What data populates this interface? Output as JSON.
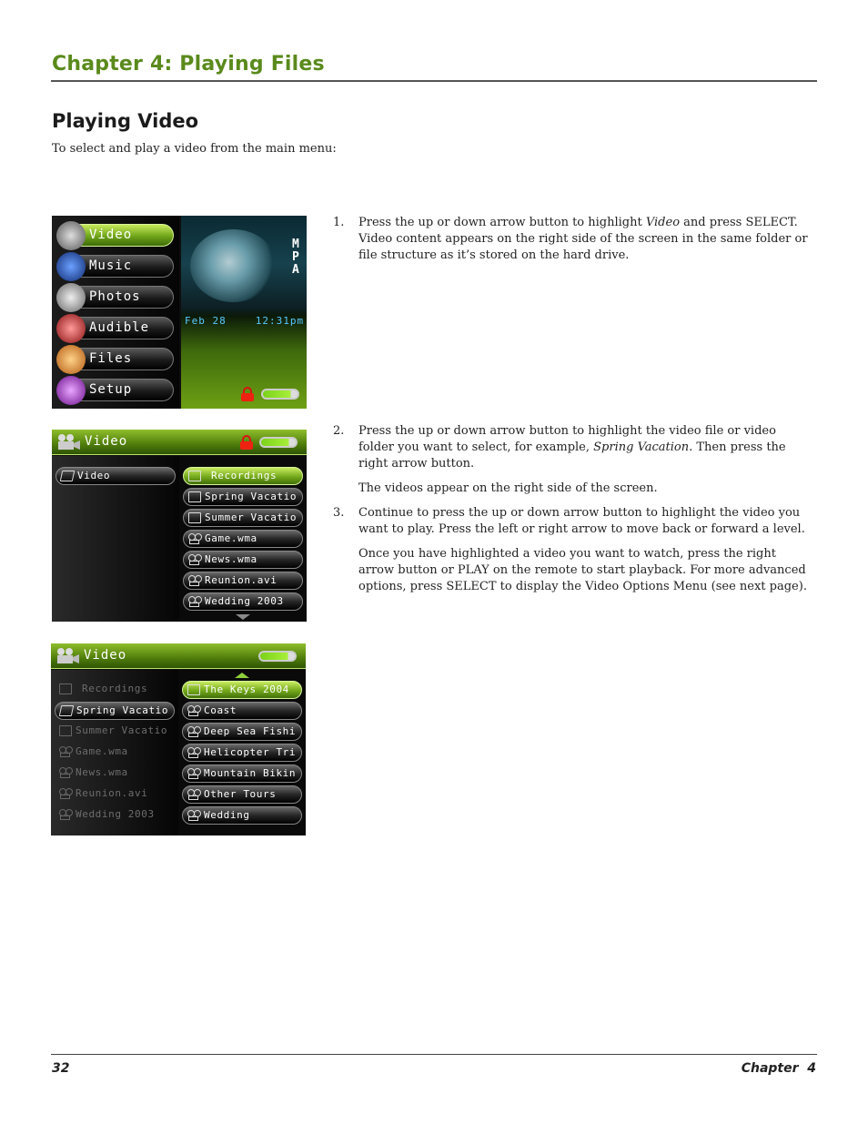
{
  "header": {
    "chapter_title": "Chapter 4: Playing Files"
  },
  "section": {
    "title": "Playing Video",
    "intro": "To select and play a video from the main menu:"
  },
  "steps": [
    {
      "num": "1.",
      "text_before": "Press the up or down arrow button to highlight ",
      "em": "Video",
      "text_after": " and press SELECT. Video content appears on the right side of the screen in the same folder or file structure as it’s stored on the hard drive."
    },
    {
      "num": "2.",
      "text_before": "Press the up or down arrow button to highlight the video file or video folder you want to select, for example, ",
      "em": "Spring Vacation",
      "text_after": ". Then press the right arrow button."
    },
    {
      "note": "The videos appear on the right side of the screen."
    },
    {
      "num": "3.",
      "text": "Continue to press the up or down arrow button to highlight the video you want to play. Press the left or right arrow to move back or forward a level."
    },
    {
      "note": "Once you have highlighted a video you want to watch, press the right arrow button or PLAY on the remote to start playback. For more advanced options, press SELECT to display the Video Options Menu (see next page)."
    }
  ],
  "screen1": {
    "menu": [
      {
        "label": "Video",
        "icon": "video-camera-icon",
        "selected": true
      },
      {
        "label": "Music",
        "icon": "headphones-icon",
        "selected": false
      },
      {
        "label": "Photos",
        "icon": "camera-icon",
        "selected": false
      },
      {
        "label": "Audible",
        "icon": "audible-icon",
        "selected": false
      },
      {
        "label": "Files",
        "icon": "folder-icon",
        "selected": false
      },
      {
        "label": "Setup",
        "icon": "setup-icon",
        "selected": false
      }
    ],
    "date": "Feb 28",
    "time": "12:31pm",
    "side_text": "MPA"
  },
  "screen2": {
    "title": "Video",
    "left": [
      {
        "label": "Video",
        "icon": "open-folder-icon"
      }
    ],
    "right": [
      {
        "label": "Recordings",
        "icon": "folder-icon",
        "highlighted": true
      },
      {
        "label": "Spring Vacatio",
        "icon": "folder-icon",
        "highlighted": false
      },
      {
        "label": "Summer Vacatio",
        "icon": "folder-icon",
        "highlighted": false
      },
      {
        "label": "Game.wma",
        "icon": "video-file-icon",
        "highlighted": false
      },
      {
        "label": "News.wma",
        "icon": "video-file-icon",
        "highlighted": false
      },
      {
        "label": "Reunion.avi",
        "icon": "video-file-icon",
        "highlighted": false
      },
      {
        "label": "Wedding 2003",
        "icon": "video-file-icon",
        "highlighted": false
      }
    ]
  },
  "screen3": {
    "title": "Video",
    "left": [
      {
        "label": "Recordings",
        "icon": "folder-icon",
        "state": "dim"
      },
      {
        "label": "Spring Vacatio",
        "icon": "open-folder-icon",
        "state": "active"
      },
      {
        "label": "Summer Vacatio",
        "icon": "folder-icon",
        "state": "dim"
      },
      {
        "label": "Game.wma",
        "icon": "video-file-icon",
        "state": "dim"
      },
      {
        "label": "News.wma",
        "icon": "video-file-icon",
        "state": "dim"
      },
      {
        "label": "Reunion.avi",
        "icon": "video-file-icon",
        "state": "dim"
      },
      {
        "label": "Wedding 2003",
        "icon": "video-file-icon",
        "state": "dim"
      }
    ],
    "right": [
      {
        "label": "The Keys 2004",
        "icon": "folder-icon",
        "highlighted": true
      },
      {
        "label": "Coast",
        "icon": "video-file-icon",
        "highlighted": false
      },
      {
        "label": "Deep Sea Fishi",
        "icon": "video-file-icon",
        "highlighted": false
      },
      {
        "label": "Helicopter Tri",
        "icon": "video-file-icon",
        "highlighted": false
      },
      {
        "label": "Mountain Bikin",
        "icon": "video-file-icon",
        "highlighted": false
      },
      {
        "label": "Other Tours",
        "icon": "video-file-icon",
        "highlighted": false
      },
      {
        "label": "Wedding",
        "icon": "video-file-icon",
        "highlighted": false
      }
    ]
  },
  "footer": {
    "page_number": "32",
    "chapter_label": "Chapter  4"
  }
}
